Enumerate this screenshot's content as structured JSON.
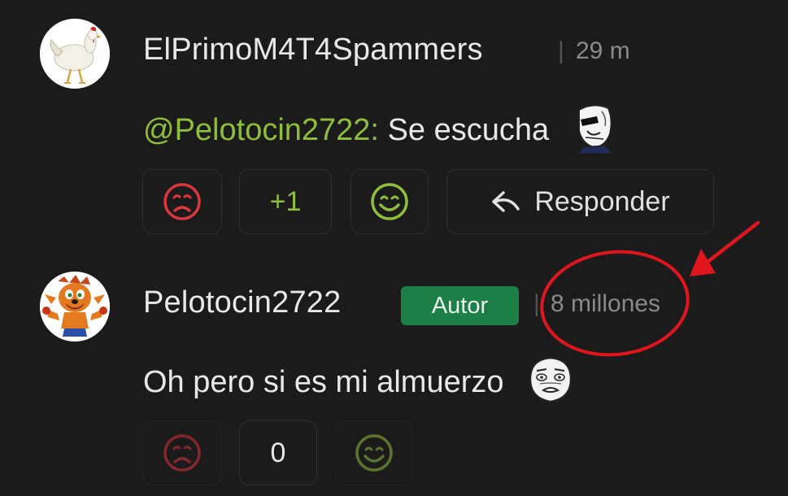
{
  "comments": [
    {
      "username": "ElPrimoM4T4Spammers",
      "separator": "|",
      "time": "29 m",
      "mention": "@Pelotocin2722:",
      "text": "Se escucha",
      "avatar_icon": "chicken-avatar",
      "emoji_icon": "yao-ming-face-emoji",
      "actions": {
        "dislike_icon": "frown-face-icon",
        "score": "+1",
        "like_icon": "smile-face-icon",
        "reply_icon": "reply-arrow-icon",
        "reply_label": "Responder"
      }
    },
    {
      "username": "Pelotocin2722",
      "badge": "Autor",
      "separator": "|",
      "time": "8 millones",
      "text": "Oh pero si es mi almuerzo",
      "avatar_icon": "crash-bandicoot-avatar",
      "emoji_icon": "me-gusta-face-emoji",
      "actions": {
        "dislike_icon": "frown-face-icon",
        "score": "0",
        "like_icon": "smile-face-icon"
      }
    }
  ],
  "colors": {
    "background": "#1b1b1b",
    "mention": "#8fbd3c",
    "dislike": "#d9363e",
    "like": "#8fbd3c",
    "badge": "#1c7f45",
    "annotation": "#e0161e"
  },
  "annotation": {
    "shapes": [
      "red-circle",
      "red-arrow"
    ]
  }
}
